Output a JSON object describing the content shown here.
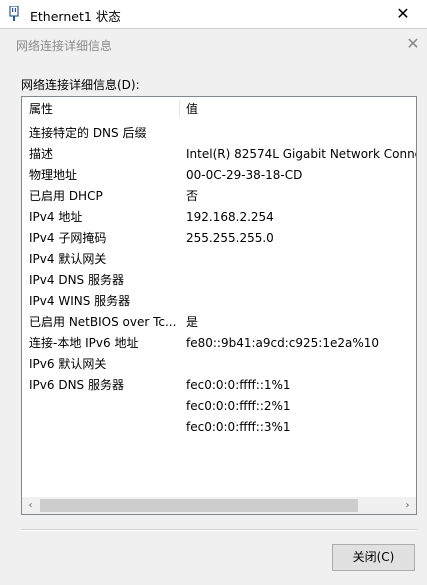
{
  "parent_window": {
    "title": "Ethernet1 状态",
    "close_glyph": "✕"
  },
  "dialog": {
    "title": "网络连接详细信息",
    "close_glyph": "✕",
    "group_label": "网络连接详细信息(D):",
    "columns": [
      "属性",
      "值"
    ],
    "rows": [
      {
        "property": "连接特定的 DNS 后缀",
        "value": ""
      },
      {
        "property": "描述",
        "value": "Intel(R) 82574L Gigabit Network Conne"
      },
      {
        "property": "物理地址",
        "value": "00-0C-29-38-18-CD"
      },
      {
        "property": "已启用 DHCP",
        "value": "否"
      },
      {
        "property": "IPv4 地址",
        "value": "192.168.2.254"
      },
      {
        "property": "IPv4 子网掩码",
        "value": "255.255.255.0"
      },
      {
        "property": "IPv4 默认网关",
        "value": ""
      },
      {
        "property": "IPv4 DNS 服务器",
        "value": ""
      },
      {
        "property": "IPv4 WINS 服务器",
        "value": ""
      },
      {
        "property": "已启用 NetBIOS over Tc...",
        "value": "是"
      },
      {
        "property": "连接-本地 IPv6 地址",
        "value": "fe80::9b41:a9cd:c925:1e2a%10"
      },
      {
        "property": "IPv6 默认网关",
        "value": ""
      },
      {
        "property": "IPv6 DNS 服务器",
        "value": "fec0:0:0:ffff::1%1"
      },
      {
        "property": "",
        "value": "fec0:0:0:ffff::2%1"
      },
      {
        "property": "",
        "value": "fec0:0:0:ffff::3%1"
      }
    ],
    "scroll_left_glyph": "‹",
    "scroll_right_glyph": "›",
    "close_button_label": "关闭(C)"
  },
  "icons": {
    "parent": "network-adapter-icon"
  },
  "colors": {
    "dialog_bg": "#f0f0f0",
    "listview_border": "#828790",
    "button_bg": "#e1e1e1"
  }
}
